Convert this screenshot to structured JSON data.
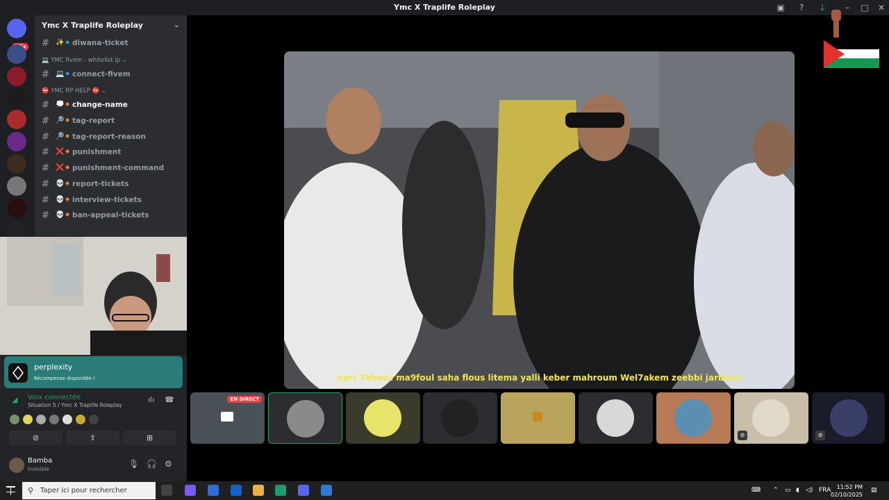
{
  "window": {
    "title": "Ymc X Traplife Roleplay"
  },
  "servers": {
    "badge": "1K+"
  },
  "guild": {
    "name": "Ymc X Traplife Roleplay"
  },
  "channels": [
    {
      "type": "channel",
      "emoji": "✨",
      "label": "diwana-ticket"
    },
    {
      "type": "category",
      "label": "💻 YMC fivem - whitelist ip ⌄"
    },
    {
      "type": "channel",
      "emoji": "💻",
      "label": "connect-fivem"
    },
    {
      "type": "category",
      "label": "⛔ YMC RP HELP ⛔ ⌄"
    },
    {
      "type": "channel",
      "emoji": "💭",
      "label": "change-name",
      "active": true
    },
    {
      "type": "channel",
      "emoji": "🔎",
      "label": "tag-report"
    },
    {
      "type": "channel",
      "emoji": "🔎",
      "label": "tag-report-reason"
    },
    {
      "type": "channel",
      "emoji": "❌",
      "label": "punishment"
    },
    {
      "type": "channel",
      "emoji": "❌",
      "label": "punishment-command"
    },
    {
      "type": "channel",
      "emoji": "💀",
      "label": "report-tickets"
    },
    {
      "type": "channel",
      "emoji": "💀",
      "label": "interview-tickets"
    },
    {
      "type": "channel",
      "emoji": "💀",
      "label": "ban-appeal-tickets"
    }
  ],
  "promo": {
    "title": "perplexity",
    "subtitle": "Récompense disponible !"
  },
  "voice": {
    "status": "Voix connectée",
    "location": "Situation 5 / Ymc X Traplife Roleplay"
  },
  "user": {
    "name": "Bamba",
    "status": "Invisible"
  },
  "stream": {
    "subtitle": "narr Tkhawi ma9foul saha flous litema yalli keber mahroum Wel7akem zeebbi jarbou3"
  },
  "tiles": {
    "live_badge": "EN DIRECT"
  },
  "taskbar": {
    "search_placeholder": "Taper ici pour rechercher",
    "language": "FRA",
    "time": "11:52 PM",
    "date": "02/10/2025"
  },
  "colors": {
    "accent_green": "#23a55a",
    "promo_teal": "#2a7c78",
    "subtitle_yellow": "#f2e84a"
  }
}
